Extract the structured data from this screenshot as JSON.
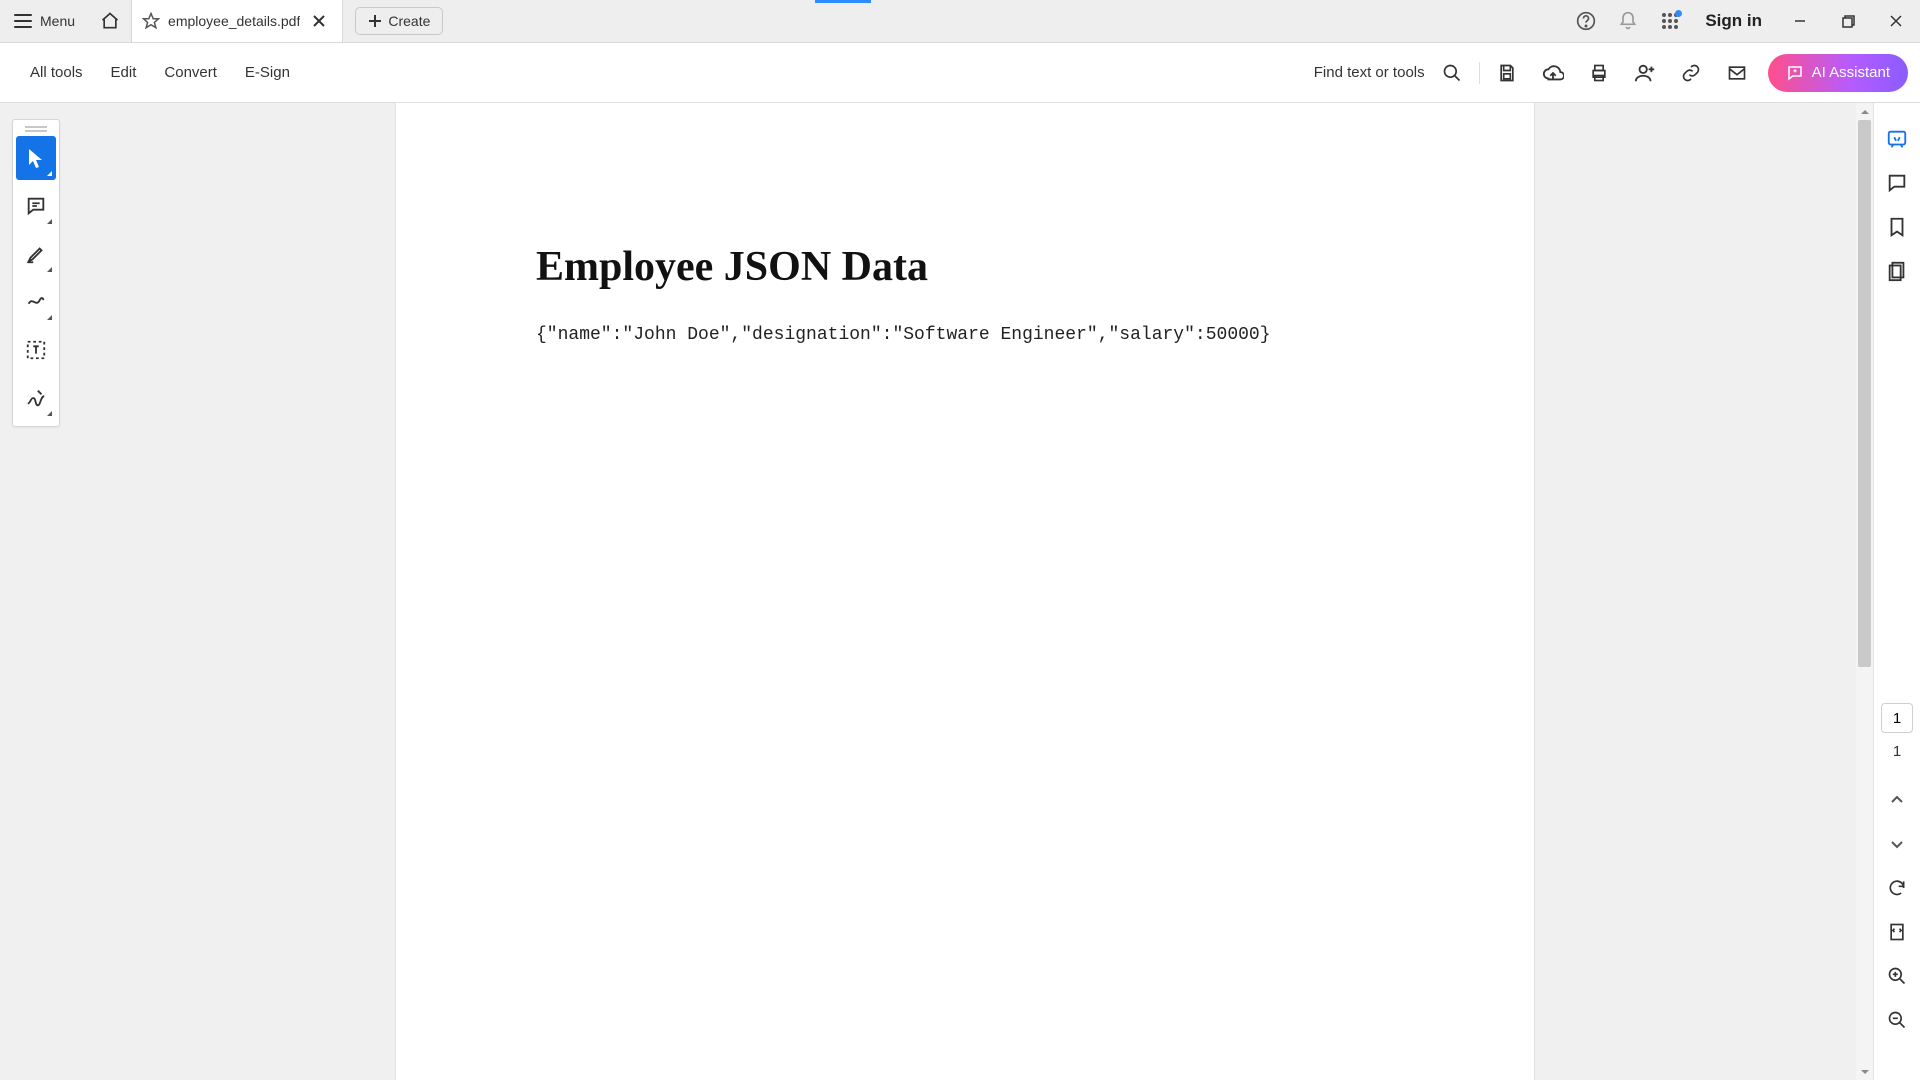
{
  "titlebar": {
    "menu_label": "Menu",
    "tab_name": "employee_details.pdf",
    "create_label": "Create",
    "signin_label": "Sign in"
  },
  "toolbar": {
    "all_tools": "All tools",
    "edit": "Edit",
    "convert": "Convert",
    "esign": "E-Sign",
    "find_label": "Find text or tools",
    "ai_label": "AI Assistant"
  },
  "document": {
    "title": "Employee JSON Data",
    "body": "{\"name\":\"John Doe\",\"designation\":\"Software Engineer\",\"salary\":50000}"
  },
  "pager": {
    "current": "1",
    "total": "1"
  }
}
